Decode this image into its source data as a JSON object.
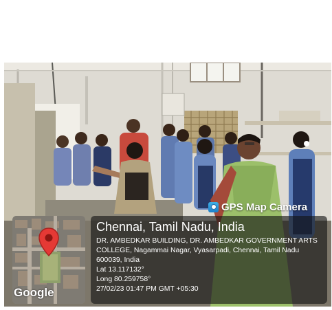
{
  "badge": {
    "app_label": "GPS Map Camera",
    "icon": "gps-camera-icon"
  },
  "map": {
    "logo_text": "Google",
    "pin_icon": "map-pin-icon"
  },
  "location": {
    "title": "Chennai, Tamil Nadu, India",
    "address": "DR. AMBEDKAR BUILDING, DR. AMBEDKAR GOVERNMENT ARTS COLLEGE, Nagammai Nagar, Vyasarpadi, Chennai, Tamil Nadu 600039, India",
    "lat": "Lat 13.117132°",
    "long": "Long 80.259758°",
    "timestamp": "27/02/23 01:47 PM GMT +05:30"
  },
  "colors": {
    "panel_bg": "#141414",
    "pin": "#e53935",
    "saree": "#9cc06a"
  }
}
